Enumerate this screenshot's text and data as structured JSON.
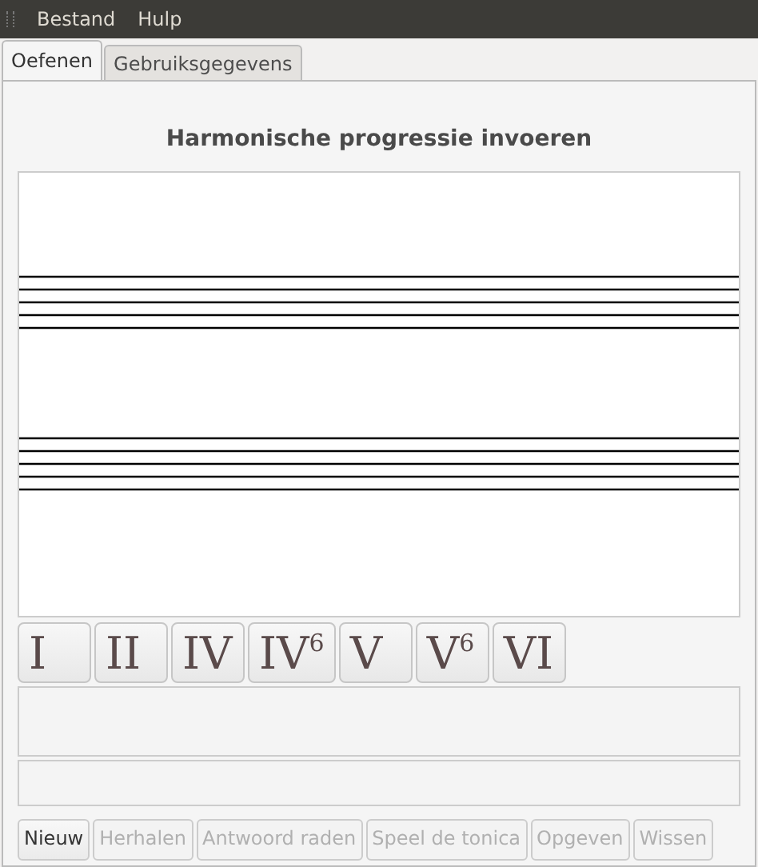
{
  "menu": [
    "Bestand",
    "Hulp"
  ],
  "tabs": [
    {
      "label": "Oefenen",
      "selected": true
    },
    {
      "label": "Gebruiksgegevens",
      "selected": false
    }
  ],
  "title": "Harmonische progressie invoeren",
  "chords": [
    "I",
    "II",
    "IV",
    "IV$^{6}$",
    "V",
    "V$^{6}$",
    "VI"
  ],
  "buttons": [
    {
      "label": "Nieuw",
      "disabled": false
    },
    {
      "label": "Herhalen",
      "disabled": true
    },
    {
      "label": "Antwoord raden",
      "disabled": true
    },
    {
      "label": "Speel de tonica",
      "disabled": true
    },
    {
      "label": "Opgeven",
      "disabled": true
    },
    {
      "label": "Wissen",
      "disabled": true
    }
  ]
}
